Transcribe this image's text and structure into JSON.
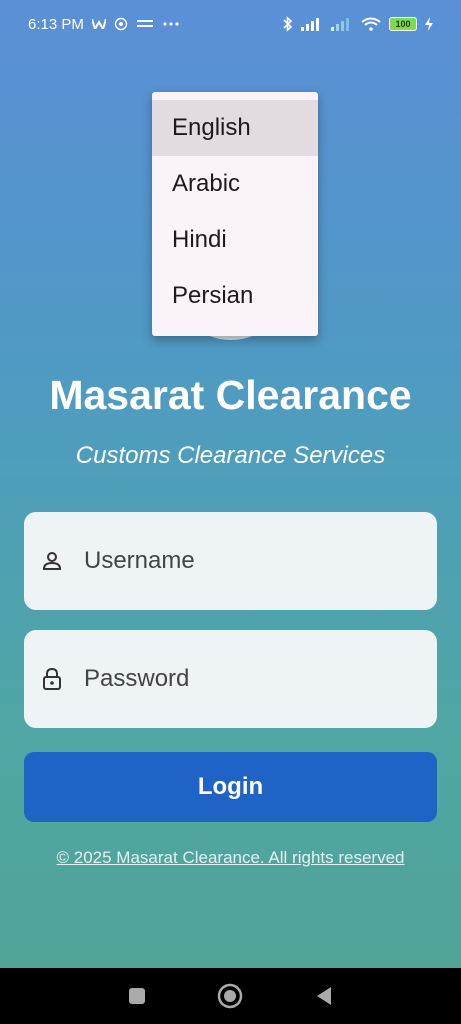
{
  "status_bar": {
    "time": "6:13 PM",
    "battery": "100"
  },
  "language_menu": {
    "items": [
      {
        "label": "English",
        "selected": true
      },
      {
        "label": "Arabic",
        "selected": false
      },
      {
        "label": "Hindi",
        "selected": false
      },
      {
        "label": "Persian",
        "selected": false
      }
    ]
  },
  "header": {
    "title": "Masarat Clearance",
    "subtitle": "Customs Clearance Services"
  },
  "form": {
    "username_placeholder": "Username",
    "password_placeholder": "Password",
    "login_label": "Login"
  },
  "footer": {
    "copyright": "© 2025 Masarat Clearance. All rights reserved"
  },
  "icons": {
    "username": "person-icon",
    "password": "lock-icon",
    "nav_recents": "square-icon",
    "nav_home": "circle-icon",
    "nav_back": "triangle-back-icon"
  },
  "colors": {
    "login_button": "#1e63c5",
    "field_background": "#eef3f6",
    "menu_background": "#fbf3fa",
    "menu_selected": "#e2dbe0"
  }
}
